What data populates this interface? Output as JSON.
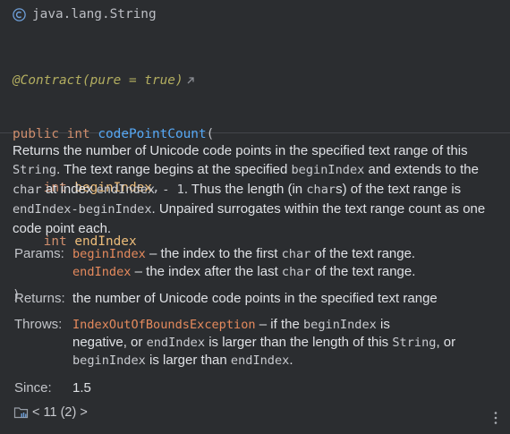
{
  "signature": {
    "class_icon": "class-c-icon",
    "class_name": "java.lang.String",
    "annotation": "@Contract(pure = true)",
    "external_link_icon": "arrow-up-right-icon",
    "kw_public": "public",
    "kw_int": "int",
    "method_name": "codePointCount",
    "open_paren": "(",
    "param1_type": "int",
    "param1_name": "beginIndex",
    "comma": ",",
    "param2_type": "int",
    "param2_name": "endIndex",
    "close_paren": ")"
  },
  "description": {
    "t1": "Returns the number of Unicode code points in the specified text range of this ",
    "c1": "String",
    "t2": ". The text range begins at the specified ",
    "c2": "beginIndex",
    "t3": " and extends to the ",
    "c3": "char",
    "t4": " at index ",
    "c4": "endIndex - 1",
    "t5": ". Thus the length (in ",
    "c5": "char",
    "t6": "s) of the text range is ",
    "c6": "endIndex-beginIndex",
    "t7": ". Unpaired surrogates within the text range count as one code point each."
  },
  "params": {
    "label": "Params:",
    "p1_name": "beginIndex",
    "p1_t1": " – the index to the first ",
    "p1_code": "char",
    "p1_t2": " of the text range.",
    "p2_name": "endIndex",
    "p2_t1": " – the index after the last ",
    "p2_code": "char",
    "p2_t2": " of the text range."
  },
  "returns": {
    "label": "Returns:",
    "text": "the number of Unicode code points in the specified text range"
  },
  "throws": {
    "label": "Throws:",
    "exception": "IndexOutOfBoundsException",
    "t1": " – if the ",
    "c1": "beginIndex",
    "t2": " is",
    "t3": "negative, or ",
    "c2": "endIndex",
    "t4": " is larger than the length of this ",
    "c3": "String",
    "t5": ", or",
    "c4": "beginIndex",
    "t6": " is larger than ",
    "c5": "endIndex",
    "t7": "."
  },
  "since": {
    "label": "Since:",
    "value": "1.5"
  },
  "footer": {
    "library_icon": "library-folder-icon",
    "text": "< 11 (2) >",
    "more_icon": "vertical-ellipsis-icon"
  },
  "colors": {
    "background": "#2b2d30",
    "keyword": "#cf8e6d",
    "method": "#56a8f5",
    "parameter": "#ecbc7a",
    "annotation": "#b3ae60",
    "link": "#e58a5d",
    "text": "#dfe1e5"
  }
}
